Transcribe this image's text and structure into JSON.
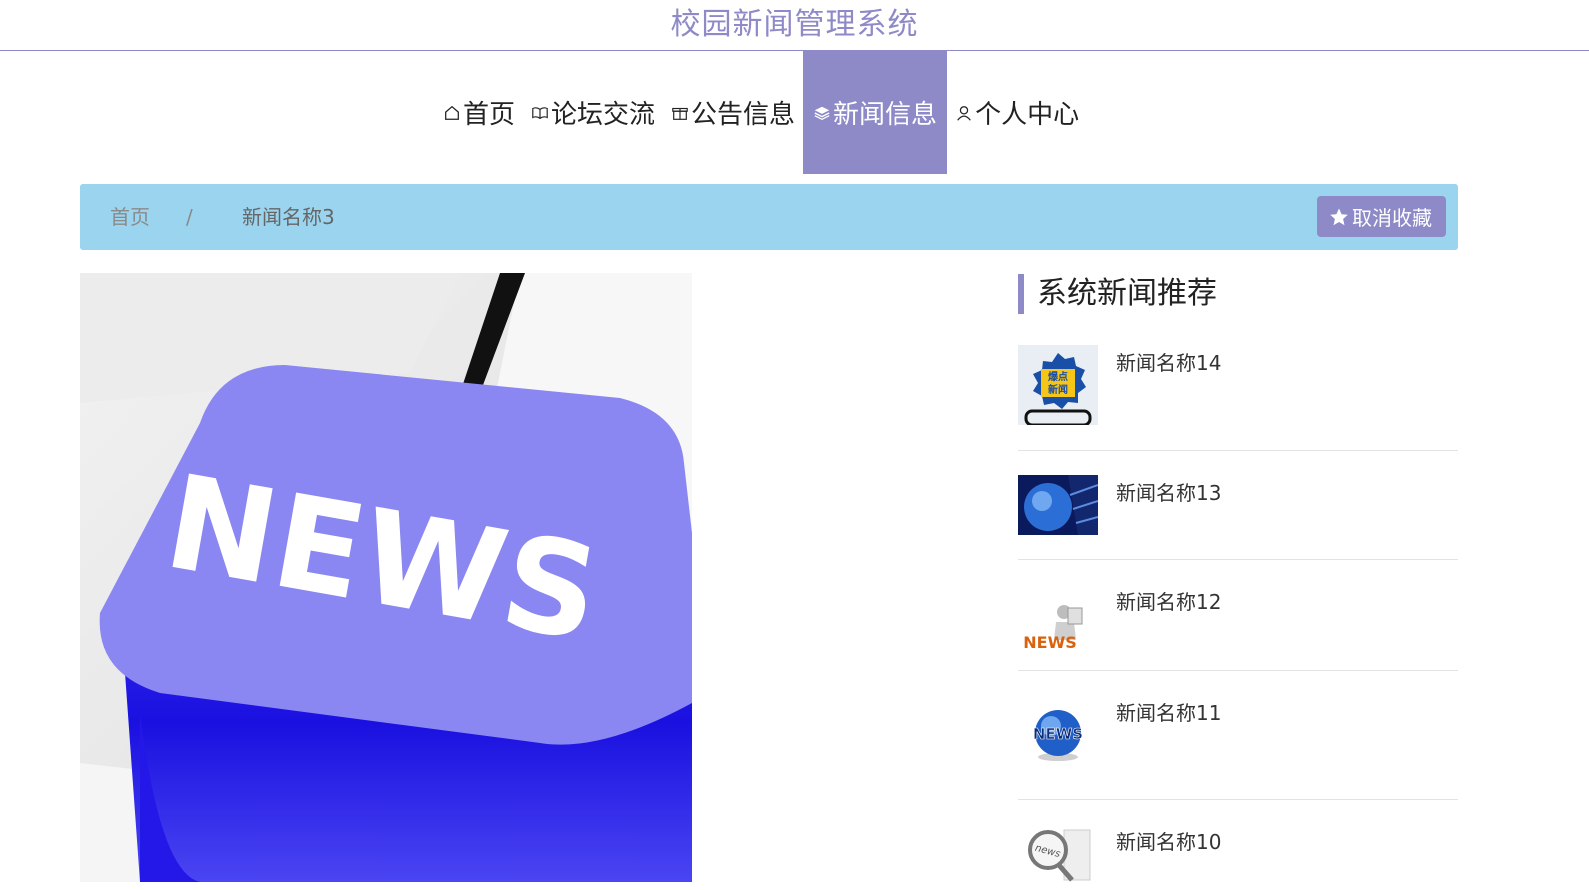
{
  "site": {
    "title": "校园新闻管理系统"
  },
  "nav": {
    "items": [
      {
        "label": "首页",
        "icon": "home-icon"
      },
      {
        "label": "论坛交流",
        "icon": "book-icon"
      },
      {
        "label": "公告信息",
        "icon": "gift-icon"
      },
      {
        "label": "新闻信息",
        "icon": "layers-icon",
        "active": true
      },
      {
        "label": "个人中心",
        "icon": "user-icon"
      }
    ]
  },
  "breadcrumb": {
    "home": "首页",
    "separator": "/",
    "current": "新闻名称3"
  },
  "actions": {
    "cancel_favorite": "取消收藏",
    "icon": "star-icon"
  },
  "article": {
    "image_text": "NEWS"
  },
  "recommend": {
    "heading": "系统新闻推荐",
    "items": [
      {
        "title": "新闻名称14",
        "thumb_text": "爆点新闻"
      },
      {
        "title": "新闻名称13"
      },
      {
        "title": "新闻名称12",
        "thumb_text": "NEWS"
      },
      {
        "title": "新闻名称11",
        "thumb_text": "NEWS"
      },
      {
        "title": "新闻名称10",
        "thumb_text": "news"
      }
    ]
  },
  "colors": {
    "accent": "#8d8ac7",
    "breadcrumb_bg": "#9ad4ee",
    "key_blue": "#2a22e6"
  }
}
